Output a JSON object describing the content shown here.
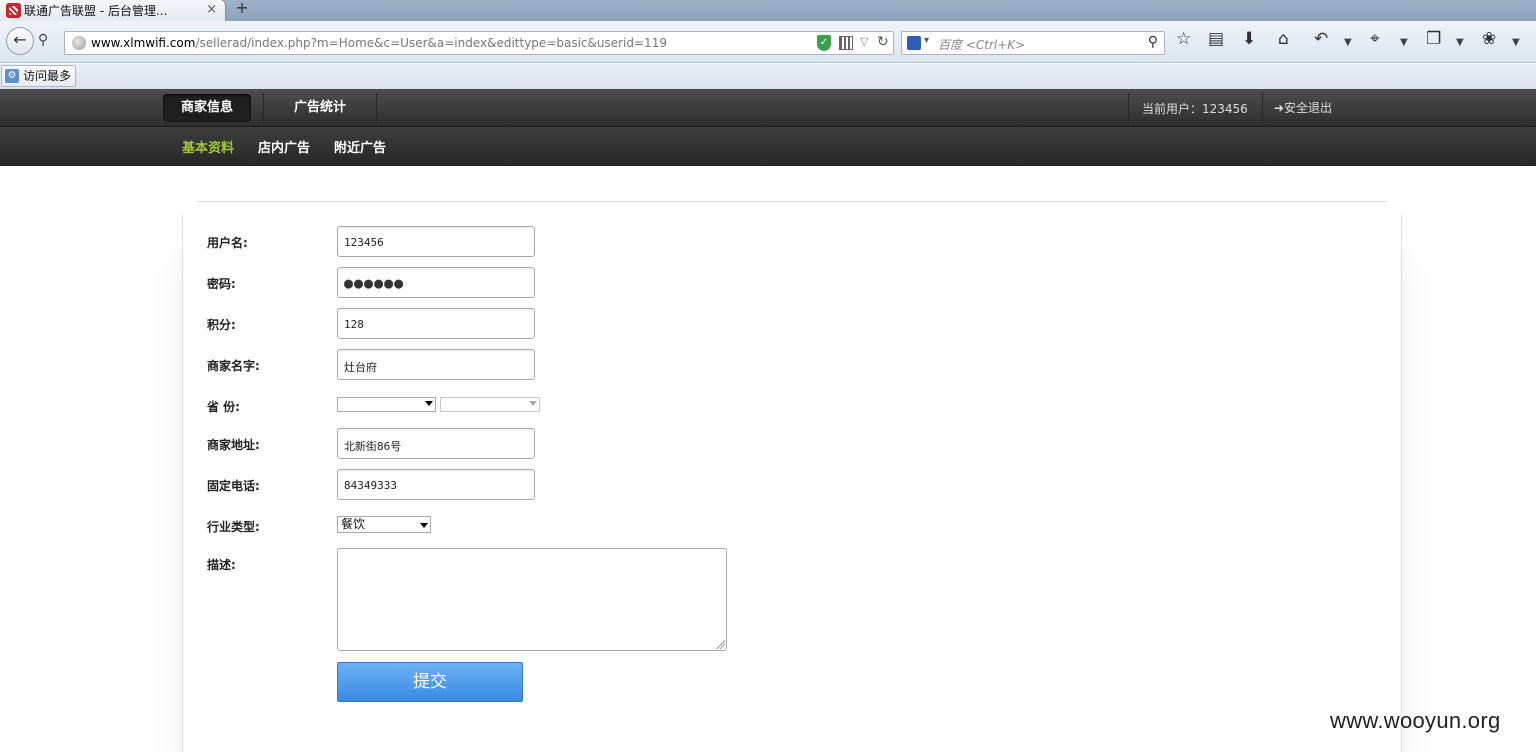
{
  "browser": {
    "tab_title": "联通广告联盟 - 后台管理...",
    "tab_close": "×",
    "new_tab": "+",
    "url_host": "www.xlmwifi.com",
    "url_path": "/sellerad/index.php?m=Home&c=User&a=index&edittype=basic&userid=119",
    "search_placeholder": "百度 <Ctrl+K>",
    "bookmark": "访问最多",
    "toolbar_icons": [
      "star-icon",
      "reading-list-icon",
      "download-icon",
      "home-icon",
      "undo-icon",
      "crop-icon",
      "window-icon",
      "bug-icon"
    ]
  },
  "app": {
    "main_tabs": [
      "商家信息",
      "广告统计"
    ],
    "user_label": "当前用户：123456",
    "logout": "➜安全退出",
    "sub_tabs": [
      "基本资料",
      "店内广告",
      "附近广告"
    ]
  },
  "form": {
    "username": {
      "label": "用户名:",
      "value": "123456"
    },
    "password": {
      "label": "密码:",
      "value": "●●●●●●"
    },
    "points": {
      "label": "积分:",
      "value": "128"
    },
    "shop_name": {
      "label": "商家名字:",
      "value": "灶台府"
    },
    "province": {
      "label": "省 份:"
    },
    "address": {
      "label": "商家地址:",
      "value": "北新街86号"
    },
    "phone": {
      "label": "固定电话:",
      "value": "84349333"
    },
    "industry": {
      "label": "行业类型:",
      "value": "餐饮"
    },
    "description": {
      "label": "描述:",
      "value": ""
    },
    "submit": "提交"
  },
  "watermark": "www.wooyun.org"
}
